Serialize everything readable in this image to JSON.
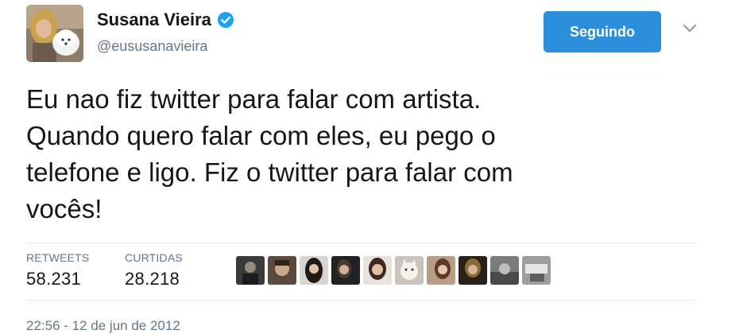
{
  "author": {
    "name": "Susana Vieira",
    "handle": "@eususanavieira",
    "verified": true
  },
  "follow_button": {
    "label": "Seguindo",
    "color": "#2b8fdc"
  },
  "tweet": {
    "text": "Eu nao fiz twitter para falar com artista.\nQuando quero falar com eles, eu pego o\ntelefone e ligo. Fiz o twitter para falar com\nvocês!"
  },
  "stats": {
    "retweets": {
      "label": "RETWEETS",
      "value": "58.231"
    },
    "likes": {
      "label": "CURTIDAS",
      "value": "28.218"
    }
  },
  "liked_by_count": 10,
  "timestamp": "22:56 - 12 de jun de 2012",
  "colors": {
    "text": "#14171a",
    "muted": "#657786",
    "verified": "#1da1f2",
    "divider": "#e1e8ed"
  }
}
